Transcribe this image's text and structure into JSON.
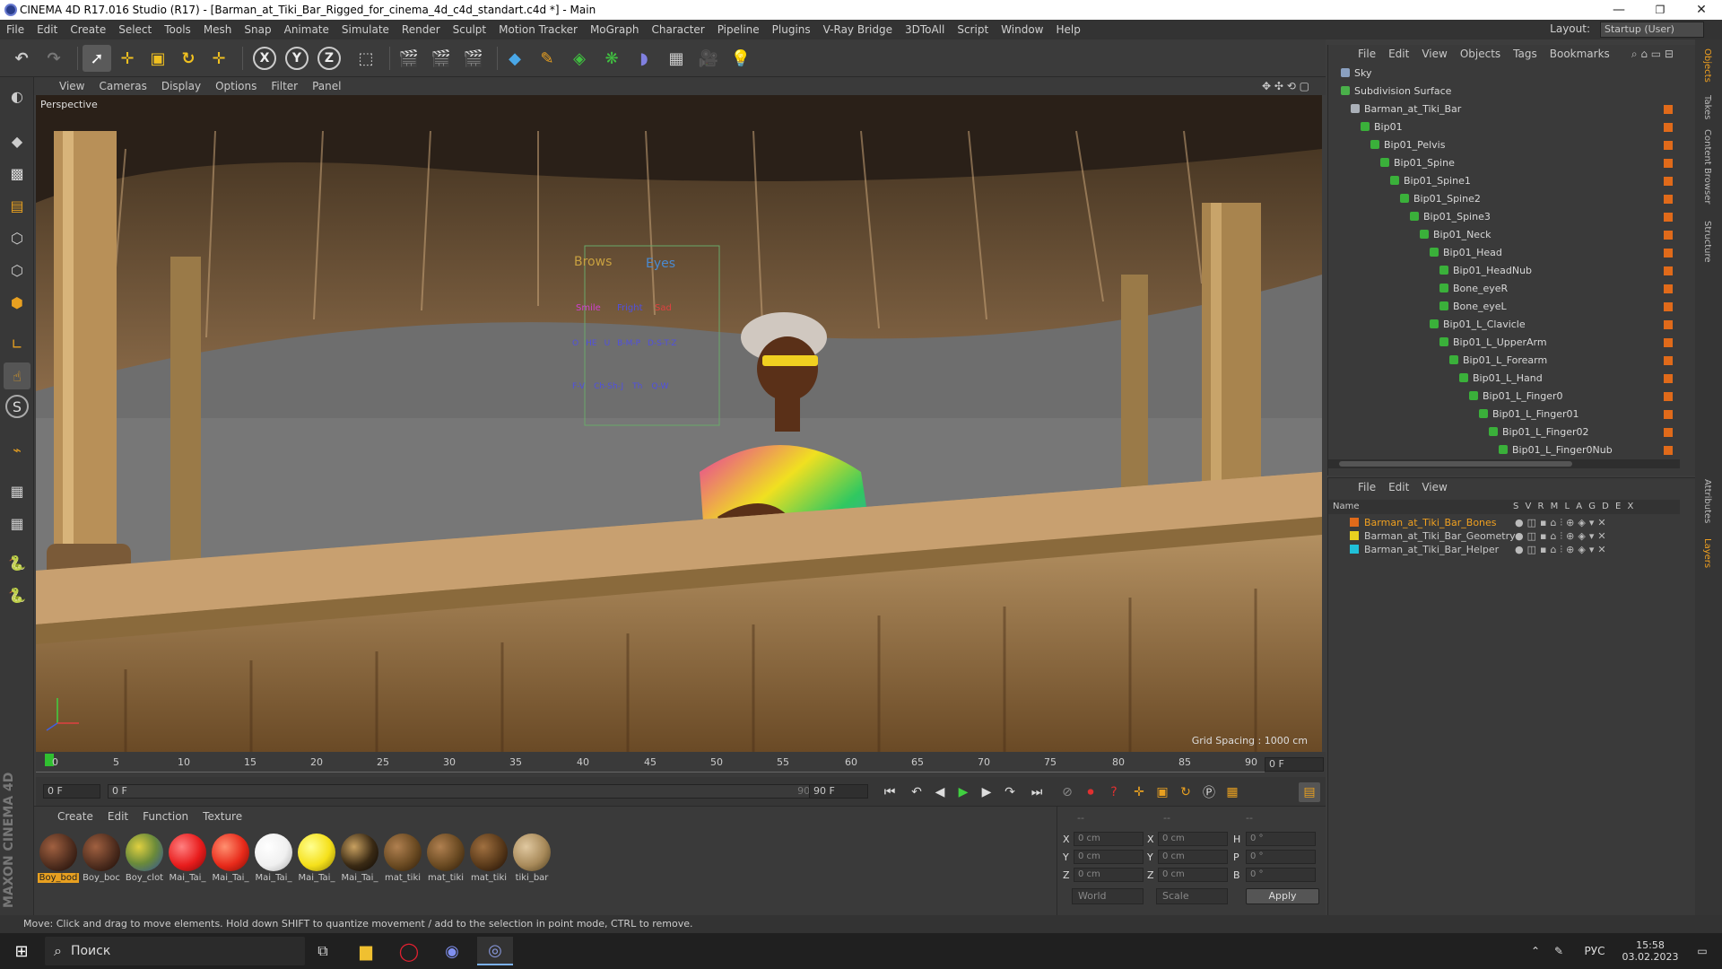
{
  "window": {
    "title": "CINEMA 4D R17.016 Studio (R17) - [Barman_at_Tiki_Bar_Rigged_for_cinema_4d_c4d_standart.c4d *] - Main",
    "minimize": "—",
    "maximize": "❐",
    "close": "✕"
  },
  "menubar": {
    "items": [
      "File",
      "Edit",
      "Create",
      "Select",
      "Tools",
      "Mesh",
      "Snap",
      "Animate",
      "Simulate",
      "Render",
      "Sculpt",
      "Motion Tracker",
      "MoGraph",
      "Character",
      "Pipeline",
      "Plugins",
      "V-Ray Bridge",
      "3DToAll",
      "Script",
      "Window",
      "Help"
    ],
    "layout_label": "Layout:",
    "layout_value": "Startup (User)"
  },
  "viewport": {
    "menu": [
      "View",
      "Cameras",
      "Display",
      "Options",
      "Filter",
      "Panel"
    ],
    "label": "Perspective",
    "grid_spacing": "Grid Spacing : 1000 cm",
    "rig_labels": {
      "brows": "Brows",
      "eyes": "Eyes",
      "smile": "Smile",
      "fright": "Fright",
      "sad": "Sad",
      "row1": [
        "O",
        "HE",
        "U",
        "B-M-P",
        "D-S-T-Z"
      ],
      "row2": [
        "F-V",
        "Ch-Sh-J",
        "Th",
        "Q-W"
      ]
    }
  },
  "timeline": {
    "ticks": [
      "0",
      "5",
      "10",
      "15",
      "20",
      "25",
      "30",
      "35",
      "40",
      "45",
      "50",
      "55",
      "60",
      "65",
      "70",
      "75",
      "80",
      "85",
      "90"
    ],
    "current_frame": "0 F"
  },
  "frame_controls": {
    "start": "0 F",
    "range_start": "0 F",
    "range_end": "90 F",
    "end": "90 F"
  },
  "materials": {
    "menu": [
      "Create",
      "Edit",
      "Function",
      "Texture"
    ],
    "items": [
      {
        "name": "Boy_bod",
        "color": "#4a2a1c"
      },
      {
        "name": "Boy_boc",
        "color": "#4a2a1c"
      },
      {
        "name": "Boy_clot",
        "color": "#6a8a3a"
      },
      {
        "name": "Mai_Tai_",
        "color": "#e81c1c"
      },
      {
        "name": "Mai_Tai_",
        "color": "#e82a1a"
      },
      {
        "name": "Mai_Tai_",
        "color": "#f0f0f0"
      },
      {
        "name": "Mai_Tai_",
        "color": "#f5e01a"
      },
      {
        "name": "Mai_Tai_",
        "color": "#3a2a14"
      },
      {
        "name": "mat_tiki",
        "color": "#6a4a22"
      },
      {
        "name": "mat_tiki",
        "color": "#6a4a22"
      },
      {
        "name": "mat_tiki",
        "color": "#5a3a1a"
      },
      {
        "name": "tiki_bar",
        "color": "#a88a5a"
      }
    ]
  },
  "coordinates": {
    "header": [
      "--",
      "--",
      "--"
    ],
    "rows": [
      {
        "axis": "X",
        "pos": "0 cm",
        "axis2": "X",
        "size": "0 cm",
        "axis3": "H",
        "rot": "0 °"
      },
      {
        "axis": "Y",
        "pos": "0 cm",
        "axis2": "Y",
        "size": "0 cm",
        "axis3": "P",
        "rot": "0 °"
      },
      {
        "axis": "Z",
        "pos": "0 cm",
        "axis2": "Z",
        "size": "0 cm",
        "axis3": "B",
        "rot": "0 °"
      }
    ],
    "mode": "World",
    "scale": "Scale",
    "apply": "Apply"
  },
  "status": "Move: Click and drag to move elements. Hold down SHIFT to quantize movement / add to the selection in point mode, CTRL to remove.",
  "objects": {
    "menu": [
      "File",
      "Edit",
      "View",
      "Objects",
      "Tags",
      "Bookmarks"
    ],
    "rows": [
      {
        "name": "Sky",
        "indent": 0,
        "icon": "#8aa0c0"
      },
      {
        "name": "Subdivision Surface",
        "indent": 0,
        "icon": "#4ab04a"
      },
      {
        "name": "Barman_at_Tiki_Bar",
        "indent": 1,
        "icon": "#aab0b8"
      },
      {
        "name": "Bip01",
        "indent": 2,
        "icon": "#3ab03a"
      },
      {
        "name": "Bip01_Pelvis",
        "indent": 3,
        "icon": "#3ab03a"
      },
      {
        "name": "Bip01_Spine",
        "indent": 4,
        "icon": "#3ab03a"
      },
      {
        "name": "Bip01_Spine1",
        "indent": 5,
        "icon": "#3ab03a"
      },
      {
        "name": "Bip01_Spine2",
        "indent": 6,
        "icon": "#3ab03a"
      },
      {
        "name": "Bip01_Spine3",
        "indent": 7,
        "icon": "#3ab03a"
      },
      {
        "name": "Bip01_Neck",
        "indent": 8,
        "icon": "#3ab03a"
      },
      {
        "name": "Bip01_Head",
        "indent": 9,
        "icon": "#3ab03a"
      },
      {
        "name": "Bip01_HeadNub",
        "indent": 10,
        "icon": "#3ab03a"
      },
      {
        "name": "Bone_eyeR",
        "indent": 10,
        "icon": "#3ab03a"
      },
      {
        "name": "Bone_eyeL",
        "indent": 10,
        "icon": "#3ab03a"
      },
      {
        "name": "Bip01_L_Clavicle",
        "indent": 9,
        "icon": "#3ab03a"
      },
      {
        "name": "Bip01_L_UpperArm",
        "indent": 10,
        "icon": "#3ab03a"
      },
      {
        "name": "Bip01_L_Forearm",
        "indent": 11,
        "icon": "#3ab03a"
      },
      {
        "name": "Bip01_L_Hand",
        "indent": 12,
        "icon": "#3ab03a"
      },
      {
        "name": "Bip01_L_Finger0",
        "indent": 13,
        "icon": "#3ab03a"
      },
      {
        "name": "Bip01_L_Finger01",
        "indent": 14,
        "icon": "#3ab03a"
      },
      {
        "name": "Bip01_L_Finger02",
        "indent": 15,
        "icon": "#3ab03a"
      },
      {
        "name": "Bip01_L_Finger0Nub",
        "indent": 16,
        "icon": "#3ab03a"
      }
    ]
  },
  "layers": {
    "menu": [
      "File",
      "Edit",
      "View"
    ],
    "head_name": "Name",
    "head_cols": "S V R M L A G D E X",
    "rows": [
      {
        "name": "Barman_at_Tiki_Bar_Bones",
        "color": "#e06a1a",
        "text": "#f0a020"
      },
      {
        "name": "Barman_at_Tiki_Bar_Geometry",
        "color": "#e8d020",
        "text": "#d8d8d8"
      },
      {
        "name": "Barman_at_Tiki_Bar_Helper",
        "color": "#20c0d8",
        "text": "#d8d8d8"
      }
    ]
  },
  "right_tabs": [
    "Objects",
    "Takes",
    "Content Browser",
    "Structure",
    "Attributes",
    "Layers"
  ],
  "taskbar": {
    "search": "Поиск",
    "lang": "РУС",
    "time": "15:58",
    "date": "03.02.2023"
  },
  "brand": "MAXON CINEMA 4D"
}
